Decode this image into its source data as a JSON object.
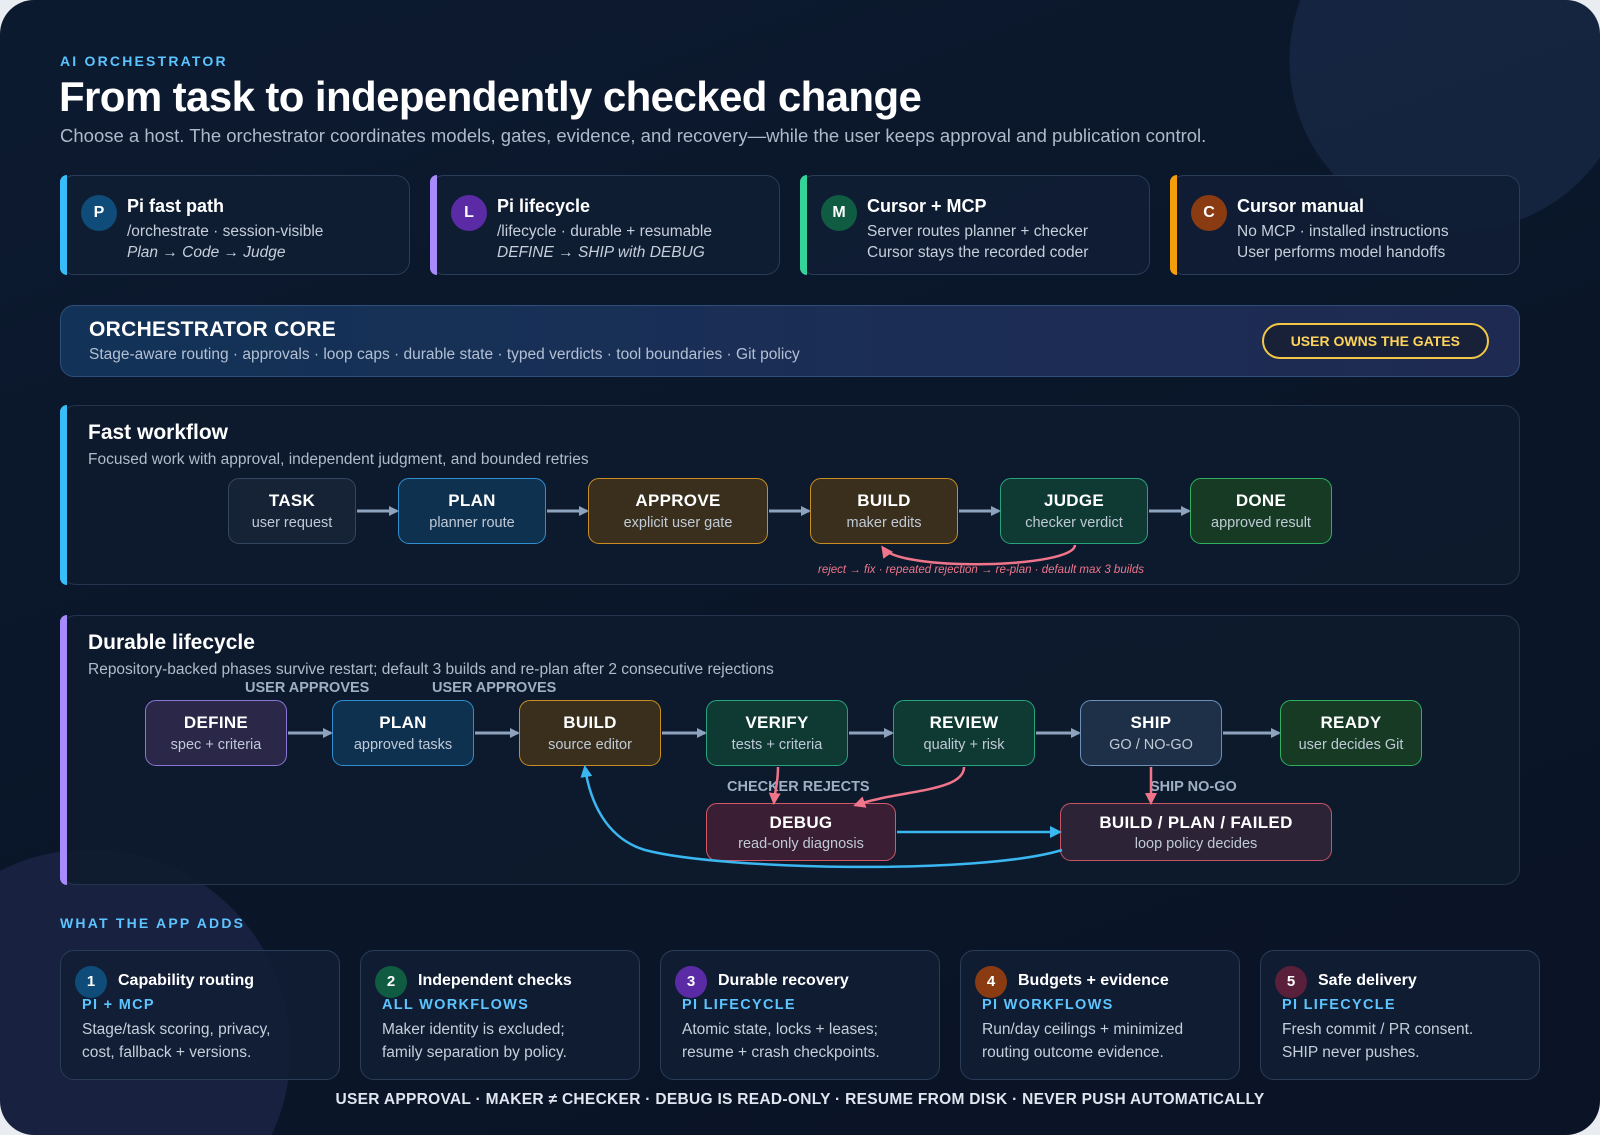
{
  "header": {
    "eyebrow": "AI ORCHESTRATOR",
    "title": "From task to independently checked change",
    "subtitle": "Choose a host. The orchestrator coordinates models, gates, evidence, and recovery—while the user keeps approval and publication control."
  },
  "hosts": [
    {
      "badge": "P",
      "title": "Pi fast path",
      "line1": "/orchestrate · session-visible",
      "line2": "Plan → Code → Judge",
      "color": "#38bdf8",
      "badge_color": "#0f4c7a"
    },
    {
      "badge": "L",
      "title": "Pi lifecycle",
      "line1": "/lifecycle · durable + resumable",
      "line2": "DEFINE → SHIP with DEBUG",
      "color": "#a78bfa",
      "badge_color": "#5b2ba6"
    },
    {
      "badge": "M",
      "title": "Cursor + MCP",
      "line1": "Server routes planner + checker",
      "line2": "Cursor stays the recorded coder",
      "color": "#34d399",
      "badge_color": "#0f5c43"
    },
    {
      "badge": "C",
      "title": "Cursor manual",
      "line1": "No MCP · installed instructions",
      "line2": "User performs model handoffs",
      "color": "#f59e0b",
      "badge_color": "#8a3b12"
    }
  ],
  "core": {
    "title": "ORCHESTRATOR CORE",
    "subtitle": "Stage-aware routing · approvals · loop caps · durable state · typed verdicts · tool boundaries · Git policy",
    "pill": "USER OWNS THE GATES"
  },
  "fast_workflow": {
    "title": "Fast workflow",
    "subtitle": "Focused work with approval, independent judgment, and bounded retries",
    "stripe_color": "#38bdf8",
    "nodes": [
      {
        "title": "TASK",
        "sub": "user request"
      },
      {
        "title": "PLAN",
        "sub": "planner route"
      },
      {
        "title": "APPROVE",
        "sub": "explicit user gate"
      },
      {
        "title": "BUILD",
        "sub": "maker edits"
      },
      {
        "title": "JUDGE",
        "sub": "checker verdict"
      },
      {
        "title": "DONE",
        "sub": "approved result"
      }
    ],
    "loop_note": "reject → fix · repeated rejection → re-plan · default max 3 builds"
  },
  "durable_lifecycle": {
    "title": "Durable lifecycle",
    "subtitle": "Repository-backed phases survive restart; default 3 builds and re-plan after 2 consecutive rejections",
    "stripe_color": "#a78bfa",
    "nodes": [
      {
        "title": "DEFINE",
        "sub": "spec + criteria"
      },
      {
        "title": "PLAN",
        "sub": "approved tasks"
      },
      {
        "title": "BUILD",
        "sub": "source editor"
      },
      {
        "title": "VERIFY",
        "sub": "tests + criteria"
      },
      {
        "title": "REVIEW",
        "sub": "quality + risk"
      },
      {
        "title": "SHIP",
        "sub": "GO / NO-GO"
      },
      {
        "title": "READY",
        "sub": "user decides Git"
      }
    ],
    "debug": {
      "title": "DEBUG",
      "sub": "read-only diagnosis"
    },
    "fallback": {
      "title": "BUILD / PLAN / FAILED",
      "sub": "loop policy decides"
    },
    "annotations": {
      "user_approves_1": "USER APPROVES",
      "user_approves_2": "USER APPROVES",
      "checker_rejects": "CHECKER REJECTS",
      "ship_no_go": "SHIP NO-GO"
    }
  },
  "adds": {
    "eyebrow": "WHAT THE APP ADDS",
    "cards": [
      {
        "num": "1",
        "title": "Capability routing",
        "tag": "PI + MCP",
        "line1": "Stage/task scoring, privacy,",
        "line2": "cost, fallback + versions.",
        "badge_color": "#0f4c7a"
      },
      {
        "num": "2",
        "title": "Independent checks",
        "tag": "ALL WORKFLOWS",
        "line1": "Maker identity is excluded;",
        "line2": "family separation by policy.",
        "badge_color": "#0f5c43"
      },
      {
        "num": "3",
        "title": "Durable recovery",
        "tag": "PI LIFECYCLE",
        "line1": "Atomic state, locks + leases;",
        "line2": "resume + crash checkpoints.",
        "badge_color": "#5b2ba6"
      },
      {
        "num": "4",
        "title": "Budgets + evidence",
        "tag": "PI WORKFLOWS",
        "line1": "Run/day ceilings + minimized",
        "line2": "routing outcome evidence.",
        "badge_color": "#8a3b12"
      },
      {
        "num": "5",
        "title": "Safe delivery",
        "tag": "PI LIFECYCLE",
        "line1": "Fresh commit / PR consent.",
        "line2": "SHIP never pushes.",
        "badge_color": "#5a1f3a"
      }
    ]
  },
  "footer": "USER APPROVAL · MAKER ≠ CHECKER · DEBUG IS READ-ONLY · RESUME FROM DISK · NEVER PUSH AUTOMATICALLY"
}
